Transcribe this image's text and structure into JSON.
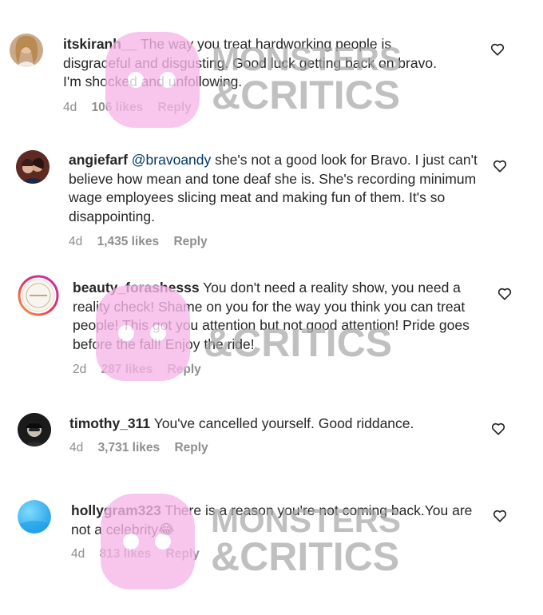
{
  "comments": [
    {
      "username": "itskiranh__",
      "mention": "",
      "text": "The way you treat hardworking people is disgraceful and disgusting. Good luck getting back on bravo. I'm shocked and unfollowing.",
      "time": "4d",
      "likes": "106 likes",
      "reply": "Reply",
      "avatar_icon": "user-photo-avatar",
      "heart_icon": "heart-outline-icon"
    },
    {
      "username": "angiefarf",
      "mention": "@bravoandy",
      "text": "she's not a good look for Bravo. I just can't believe how mean and tone deaf she is. She's recording minimum wage employees slicing meat and making fun of them. It's so disappointing.",
      "time": "4d",
      "likes": "1,435 likes",
      "reply": "Reply",
      "avatar_icon": "couple-photo-avatar",
      "heart_icon": "heart-outline-icon"
    },
    {
      "username": "beauty_forashesss",
      "mention": "",
      "text": "You don't need a reality show, you need a reality check! Shame on you for the way you think you can treat people! This got you attention but not good attention! Pride goes before the fall! Enjoy the ride!",
      "time": "2d",
      "likes": "287 likes",
      "reply": "Reply",
      "avatar_icon": "story-ring-avatar",
      "heart_icon": "heart-outline-icon"
    },
    {
      "username": "timothy_311",
      "mention": "",
      "text": "You've cancelled yourself. Good riddance.",
      "time": "4d",
      "likes": "3,731 likes",
      "reply": "Reply",
      "avatar_icon": "dark-photo-avatar",
      "heart_icon": "heart-outline-icon"
    },
    {
      "username": "hollygram323",
      "mention": "",
      "text": "There is a reason you're not coming back.You are not a celebrity😂",
      "time": "4d",
      "likes": "813 likes",
      "reply": "Reply",
      "avatar_icon": "blue-circle-avatar",
      "heart_icon": "heart-outline-icon"
    }
  ],
  "watermark": {
    "line1": "MONSTERS",
    "line2": "&CRITICS",
    "color": "#a9a9a9",
    "mascot_color": "#f7b6e8"
  }
}
